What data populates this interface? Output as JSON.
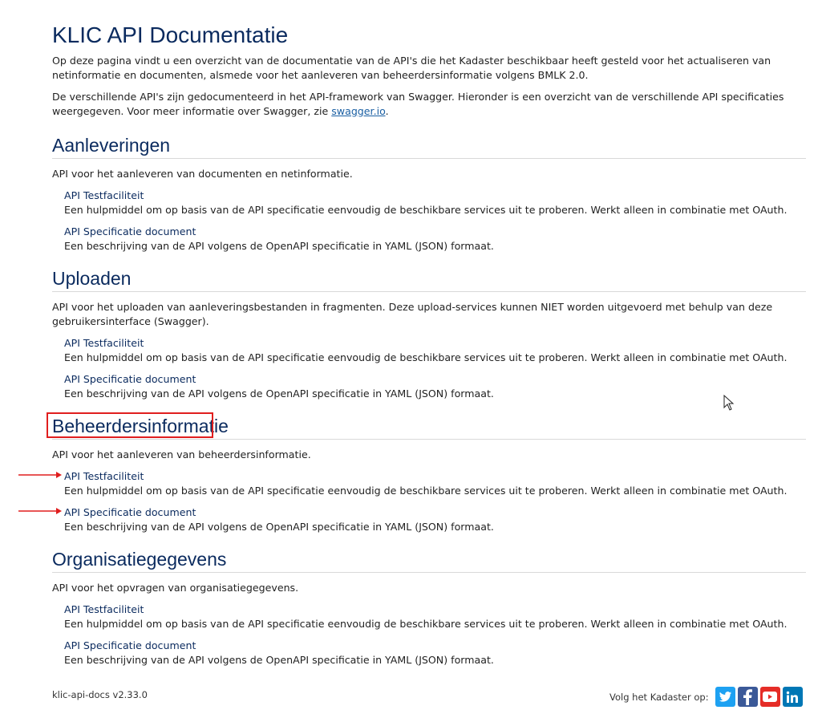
{
  "page": {
    "title": "KLIC API Documentatie",
    "intro1": "Op deze pagina vindt u een overzicht van de documentatie van de API's die het Kadaster beschikbaar heeft gesteld voor het actualiseren van netinformatie en documenten, alsmede voor het aanleveren van beheerdersinformatie volgens BMLK 2.0.",
    "intro2_prefix": "De verschillende API's zijn gedocumenteerd in het API-framework van Swagger. Hieronder is een overzicht van de verschillende API specificaties weergegeven. Voor meer informatie over Swagger, zie ",
    "intro2_link": "swagger.io",
    "intro2_suffix": "."
  },
  "sections": [
    {
      "title": "Aanleveringen",
      "description": "API voor het aanleveren van documenten en netinformatie.",
      "entries": [
        {
          "link": "API Testfaciliteit",
          "desc": "Een hulpmiddel om op basis van de API specificatie eenvoudig de beschikbare services uit te proberen. Werkt alleen in combinatie met OAuth."
        },
        {
          "link": "API Specificatie document",
          "desc": "Een beschrijving van de API volgens de OpenAPI specificatie in YAML (JSON) formaat."
        }
      ]
    },
    {
      "title": "Uploaden",
      "description": "API voor het uploaden van aanleveringsbestanden in fragmenten. Deze upload-services kunnen NIET worden uitgevoerd met behulp van deze gebruikersinterface (Swagger).",
      "entries": [
        {
          "link": "API Testfaciliteit",
          "desc": "Een hulpmiddel om op basis van de API specificatie eenvoudig de beschikbare services uit te proberen. Werkt alleen in combinatie met OAuth."
        },
        {
          "link": "API Specificatie document",
          "desc": "Een beschrijving van de API volgens de OpenAPI specificatie in YAML (JSON) formaat."
        }
      ]
    },
    {
      "title": "Beheerdersinformatie",
      "description": "API voor het aanleveren van beheerdersinformatie.",
      "entries": [
        {
          "link": "API Testfaciliteit",
          "desc": "Een hulpmiddel om op basis van de API specificatie eenvoudig de beschikbare services uit te proberen. Werkt alleen in combinatie met OAuth."
        },
        {
          "link": "API Specificatie document",
          "desc": "Een beschrijving van de API volgens de OpenAPI specificatie in YAML (JSON) formaat."
        }
      ]
    },
    {
      "title": "Organisatiegegevens",
      "description": "API voor het opvragen van organisatiegegevens.",
      "entries": [
        {
          "link": "API Testfaciliteit",
          "desc": "Een hulpmiddel om op basis van de API specificatie eenvoudig de beschikbare services uit te proberen. Werkt alleen in combinatie met OAuth."
        },
        {
          "link": "API Specificatie document",
          "desc": "Een beschrijving van de API volgens de OpenAPI specificatie in YAML (JSON) formaat."
        }
      ]
    }
  ],
  "footer": {
    "version": "klic-api-docs v2.33.0",
    "follow_label": "Volg het Kadaster op:",
    "social": [
      {
        "icon": "twitter-icon",
        "color": "#1da1f2"
      },
      {
        "icon": "facebook-icon",
        "color": "#3b5998"
      },
      {
        "icon": "youtube-icon",
        "color": "#e52d27"
      },
      {
        "icon": "linkedin-icon",
        "color": "#0077b5"
      }
    ]
  },
  "colors": {
    "heading": "#0a2a5e",
    "link": "#1a5fa3",
    "annotation": "#e01e1e"
  }
}
